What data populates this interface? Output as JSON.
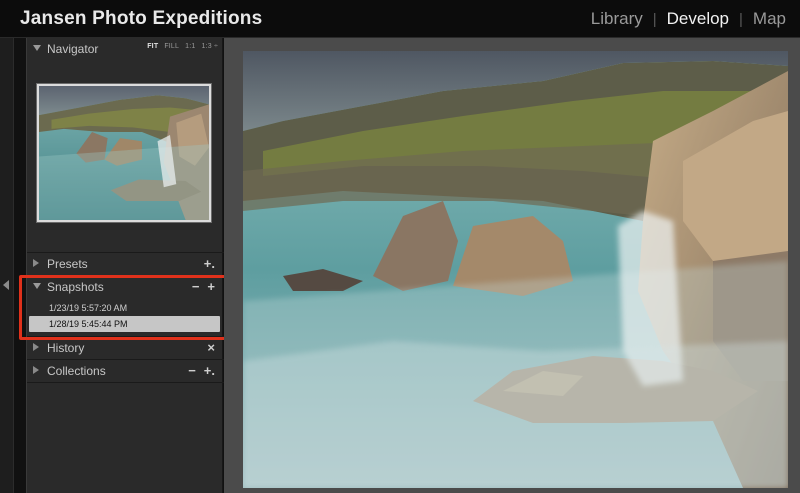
{
  "app": {
    "brand_title": "Jansen Photo Expeditions"
  },
  "modules": {
    "library": "Library",
    "develop": "Develop",
    "map": "Map",
    "separator": "|"
  },
  "navigator": {
    "title": "Navigator",
    "zoom_options": [
      "FIT",
      "FILL",
      "1:1",
      "1:3 ÷"
    ],
    "active_option": "FIT"
  },
  "panels": {
    "presets": {
      "title": "Presets",
      "action": "+."
    },
    "snapshots": {
      "title": "Snapshots",
      "minus": "−",
      "plus": "+",
      "items": [
        {
          "label": "1/23/19 5:57:20 AM",
          "selected": false
        },
        {
          "label": "1/28/19 5:45:44 PM",
          "selected": true
        }
      ]
    },
    "history": {
      "title": "History",
      "action": "×"
    },
    "collections": {
      "title": "Collections",
      "minus": "−",
      "plus": "+."
    }
  },
  "colors": {
    "highlight_box": "#e0311b",
    "selected_row": "#c6c6c6"
  }
}
